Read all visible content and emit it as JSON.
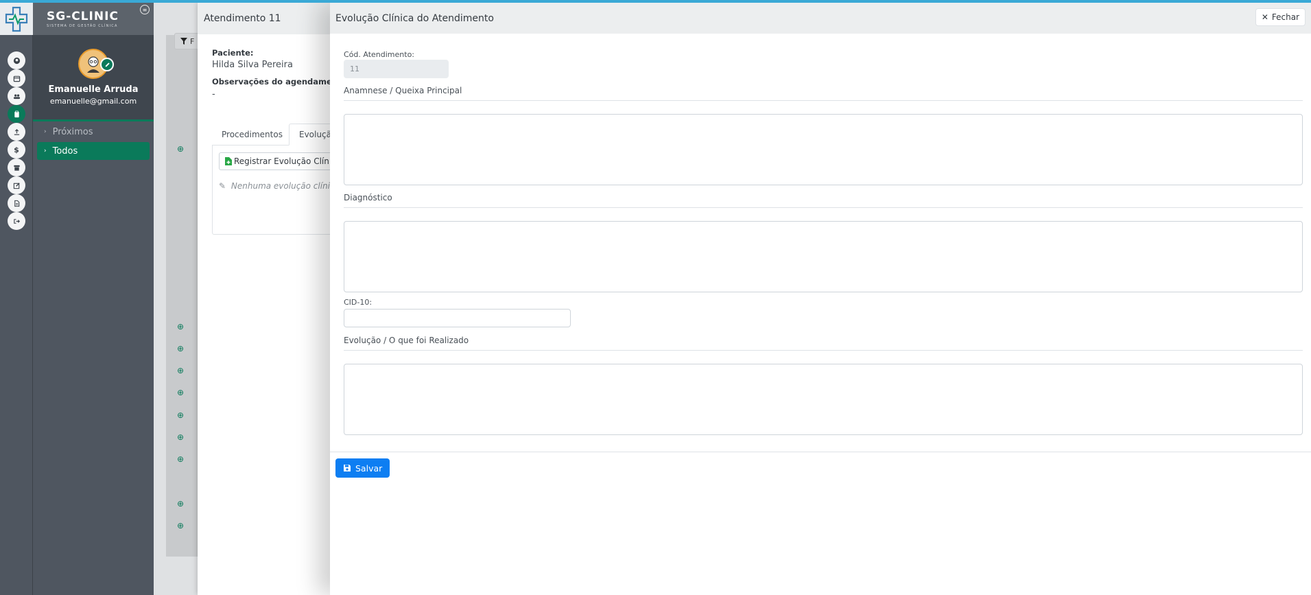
{
  "app": {
    "brand_name": "SG-CLINIC",
    "brand_subtitle": "SISTEMA DE GESTÃO CLÍNICA"
  },
  "user": {
    "name": "Emanuelle Arruda",
    "email": "emanuelle@gmail.com"
  },
  "rail_icons": [
    "user-icon",
    "calendar-icon",
    "users-icon",
    "clipboard-icon",
    "upload-icon",
    "dollar-icon",
    "archive-icon",
    "edit-icon",
    "file-icon",
    "logout-icon"
  ],
  "sidebar": {
    "items": [
      {
        "label": "Próximos"
      },
      {
        "label": "Todos"
      }
    ]
  },
  "background": {
    "filter_label": "F"
  },
  "atendimento": {
    "title": "Atendimento 11",
    "patient_label": "Paciente:",
    "patient_name": "Hilda Silva Pereira",
    "notes_label": "Observações do agendamento",
    "notes_value": "-",
    "tabs": [
      {
        "label": "Procedimentos"
      },
      {
        "label": "Evoluçã"
      }
    ],
    "register_button": "Registrar Evolução Clínica",
    "empty_message": "Nenhuma evolução clínica"
  },
  "evolucao": {
    "title": "Evolução Clínica do Atendimento",
    "close_label": "Fechar",
    "cod_label": "Cód. Atendimento:",
    "cod_value": "11",
    "anamnese_label": "Anamnese / Queixa Principal",
    "diagnostico_label": "Diagnóstico",
    "cid_label": "CID-10:",
    "cid_value": "",
    "evolucao_label": "Evolução / O que foi Realizado",
    "save_label": "Salvar"
  },
  "colors": {
    "accent": "#0a7a5a",
    "primary": "#0d7ef2",
    "topbar": "#3aa9d6"
  }
}
